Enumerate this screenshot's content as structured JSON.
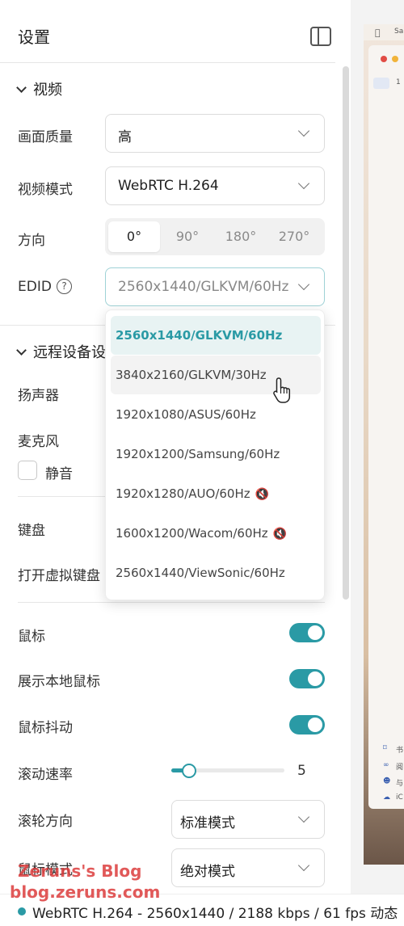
{
  "panel": {
    "title": "设置"
  },
  "video": {
    "section_title": "视频",
    "quality": {
      "label": "画面质量",
      "value": "高"
    },
    "mode": {
      "label": "视频模式",
      "value": "WebRTC H.264"
    },
    "orientation": {
      "label": "方向",
      "options": [
        "0°",
        "90°",
        "180°",
        "270°"
      ],
      "selected": "0°"
    },
    "edid": {
      "label": "EDID",
      "value": "2560x1440/GLKVM/60Hz"
    }
  },
  "edid_dropdown": {
    "options": [
      "2560x1440/GLKVM/60Hz",
      "3840x2160/GLKVM/30Hz",
      "1920x1080/ASUS/60Hz",
      "1920x1200/Samsung/60Hz",
      "1920x1280/AUO/60Hz",
      "1600x1200/Wacom/60Hz",
      "2560x1440/ViewSonic/60Hz"
    ],
    "selected_index": 0,
    "hover_index": 1,
    "muted_indices": [
      4,
      5
    ]
  },
  "remote": {
    "section_title": "远程设备设置",
    "speaker_label": "扬声器",
    "mic_label": "麦克风",
    "mute_label": "静音",
    "keyboard_label": "键盘",
    "virtual_keyboard_label": "打开虚拟键盘"
  },
  "mouse": {
    "mouse_label": "鼠标",
    "mouse_on": true,
    "show_local_label": "展示本地鼠标",
    "show_local_on": true,
    "jiggle_label": "鼠标抖动",
    "jiggle_on": true,
    "scroll_rate_label": "滚动速率",
    "scroll_rate_value": "5",
    "scroll_rate_fraction": 0.15,
    "wheel_dir_label": "滚轮方向",
    "wheel_dir_value": "标准模式",
    "mouse_mode_label": "鼠标模式",
    "mouse_mode_value": "绝对模式"
  },
  "status_bar": {
    "text": "WebRTC H.264 - 2560x1440 /  2188 kbps / 61 fps 动态"
  },
  "watermark": {
    "line1": "Zeruns's Blog",
    "line2": "blog.zeruns.com"
  },
  "preview": {
    "menubar_text": "Sa",
    "tab_text": "1",
    "sidebar_items": [
      "书",
      "阅",
      "与",
      "iC"
    ]
  },
  "colors": {
    "accent": "#2a9aa5",
    "selected_bg": "#e8f3f3",
    "watermark": "#dc3c3c"
  }
}
